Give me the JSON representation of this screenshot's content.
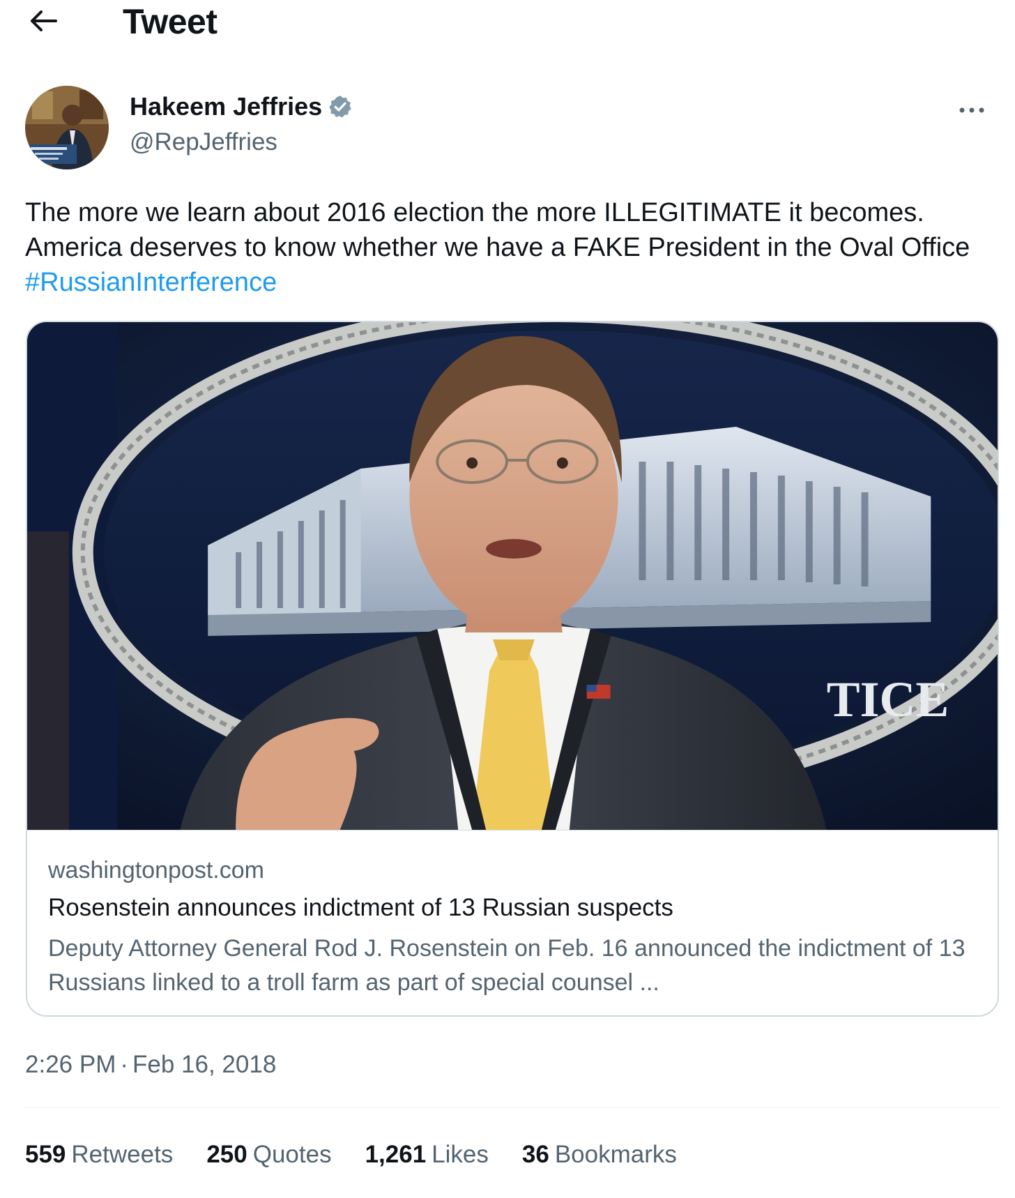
{
  "header": {
    "back_icon": "arrow-left-icon",
    "title": "Tweet"
  },
  "author": {
    "name": "Hakeem Jeffries",
    "handle": "@RepJeffries",
    "verified_icon": "verified-badge-icon",
    "verified_color": "#829aab",
    "more_icon": "more-horizontal-icon"
  },
  "tweet": {
    "text": "The more we learn about 2016 election the more ILLEGITIMATE it becomes. America deserves to know whether we have a FAKE President in the Oval Office",
    "hashtag": "#RussianInterference",
    "hashtag_color": "#1d9bf0"
  },
  "card": {
    "domain": "washingtonpost.com",
    "title": "Rosenstein announces indictment of 13 Russian suspects",
    "description": "Deputy Attorney General Rod J. Rosenstein on Feb. 16 announced the indictment of 13 Russians linked to a troll farm as part of special counsel ...",
    "image_seal_text": "TICE"
  },
  "meta": {
    "time": "2:26 PM",
    "separator": "·",
    "date": "Feb 16, 2018"
  },
  "stats": [
    {
      "value": "559",
      "label": "Retweets"
    },
    {
      "value": "250",
      "label": "Quotes"
    },
    {
      "value": "1,261",
      "label": "Likes"
    },
    {
      "value": "36",
      "label": "Bookmarks"
    }
  ]
}
